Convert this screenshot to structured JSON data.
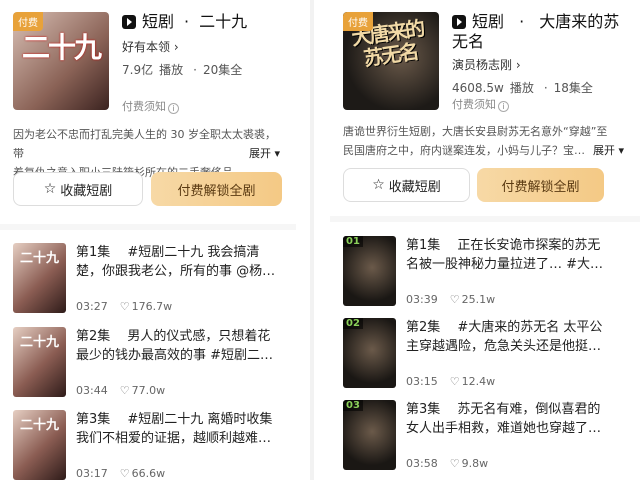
{
  "left": {
    "paid_badge": "付费",
    "poster_text": "二十九",
    "category": "短剧",
    "dot": "·",
    "title": "二十九",
    "author": "好有本领",
    "author_chevron": "›",
    "views": "7.9亿",
    "views_label": "播放",
    "episodes": "20集全",
    "notice": "付费须知",
    "notice_icon": "i",
    "desc_line1": "因为老公不忠而打乱完美人生的 30 岁全职太太裘裘，带",
    "desc_line2": "着复仇之意入职小三陆筱杉所在的二手奢侈品…",
    "more": "展开 ▾",
    "fav_button": "收藏短剧",
    "pay_button": "付费解锁全剧",
    "episodes_list": [
      {
        "line1": "第1集　 #短剧二十九  我会搞清",
        "line2": "楚，你跟我老公，所有的事 @杨…",
        "duration": "03:27",
        "likes": "176.7w",
        "thumb": "二十九"
      },
      {
        "line1": "第2集　 男人的仪式感，只想着花",
        "line2": "最少的钱办最高效的事 #短剧二…",
        "duration": "03:44",
        "likes": "77.0w",
        "thumb": "二十九"
      },
      {
        "line1": "第3集　 #短剧二十九  离婚时收集",
        "line2": "我们不相爱的证据，越顺利越难…",
        "duration": "03:17",
        "likes": "66.6w",
        "thumb": "二十九"
      }
    ]
  },
  "right": {
    "paid_badge": "付费",
    "poster_text": "大唐来的苏无名",
    "category": "短剧",
    "dot": "·",
    "title_line1": "大唐来的苏",
    "title_line2": "无名",
    "author": "演员杨志刚",
    "author_chevron": "›",
    "views": "4608.5w",
    "views_label": "播放",
    "episodes": "18集全",
    "notice": "付费须知",
    "notice_icon": "i",
    "desc_line1": "唐诡世界衍生短剧，大唐长安县尉苏无名意外“穿越”至",
    "desc_line2": "民国唐府之中，府内谜案连发，小妈与儿子？宝…",
    "more": "展开 ▾",
    "fav_button": "收藏短剧",
    "pay_button": "付费解锁全剧",
    "episodes_list": [
      {
        "line1": "第1集　 正在长安诡市探案的苏无",
        "line2": "名被一股神秘力量拉进了… #大…",
        "duration": "03:39",
        "likes": "25.1w",
        "badge": "01"
      },
      {
        "line1": "第2集　 #大唐来的苏无名  太平公",
        "line2": "主穿越遇险，危急关头还是他挺…",
        "duration": "03:15",
        "likes": "12.4w",
        "badge": "02"
      },
      {
        "line1": "第3集　 苏无名有难，倒似喜君的",
        "line2": "女人出手相救，难道她也穿越了…",
        "duration": "03:58",
        "likes": "9.8w",
        "badge": "03"
      }
    ]
  },
  "icons": {
    "heart": "♡",
    "star": "☆",
    "logo": "douyin-logo-icon"
  }
}
